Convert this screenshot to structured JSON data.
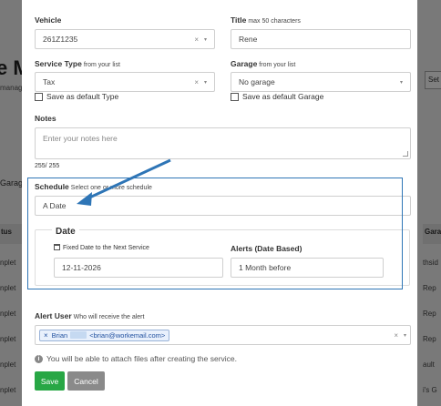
{
  "background": {
    "title_fragment": "e M",
    "subtitle_fragment": "manag",
    "garage_fragment": "Garag",
    "header_left": "tus",
    "header_right": "Gara",
    "side_button": "Set",
    "rows_left": [
      "nplet",
      "nplet",
      "nplet",
      "nplet",
      "nplet",
      "nplet",
      "nplet"
    ],
    "rows_right": [
      "thsid",
      "Rep",
      "Rep",
      "Rep",
      "ault",
      "i's G",
      ""
    ]
  },
  "form": {
    "vehicle": {
      "label": "Vehicle",
      "value": "261Z1235"
    },
    "title": {
      "label": "Title",
      "hint": "max 50 characters",
      "value": "Rene"
    },
    "service_type": {
      "label": "Service Type",
      "hint": "from your list",
      "value": "Tax",
      "default_label": "Save as default Type"
    },
    "garage": {
      "label": "Garage",
      "hint": "from your list",
      "value": "No garage",
      "default_label": "Save as default Garage"
    },
    "notes": {
      "label": "Notes",
      "placeholder": "Enter your notes here",
      "counter": "255/ 255"
    },
    "schedule": {
      "label": "Schedule",
      "hint": "Select one or more schedule",
      "value": "A Date"
    },
    "date_section": {
      "legend": "Date",
      "fixed_label": "Fixed Date to the Next Service",
      "fixed_value": "12-11-2026",
      "alerts_label": "Alerts (Date Based)",
      "alerts_value": "1 Month before"
    },
    "alert_user": {
      "label": "Alert User",
      "hint": "Who will receive the alert",
      "tag_name": "Brian",
      "tag_email": "<brian@workemail.com>"
    },
    "info_text": "You will be able to attach files after creating the service.",
    "save_label": "Save",
    "cancel_label": "Cancel"
  },
  "icons": {
    "clear": "×",
    "caret": "▾",
    "calendar": "calendar-icon",
    "info": "info-icon"
  },
  "colors": {
    "accent_blue": "#2e75b6",
    "save_green": "#28a745",
    "cancel_gray": "#8a8a8a"
  }
}
